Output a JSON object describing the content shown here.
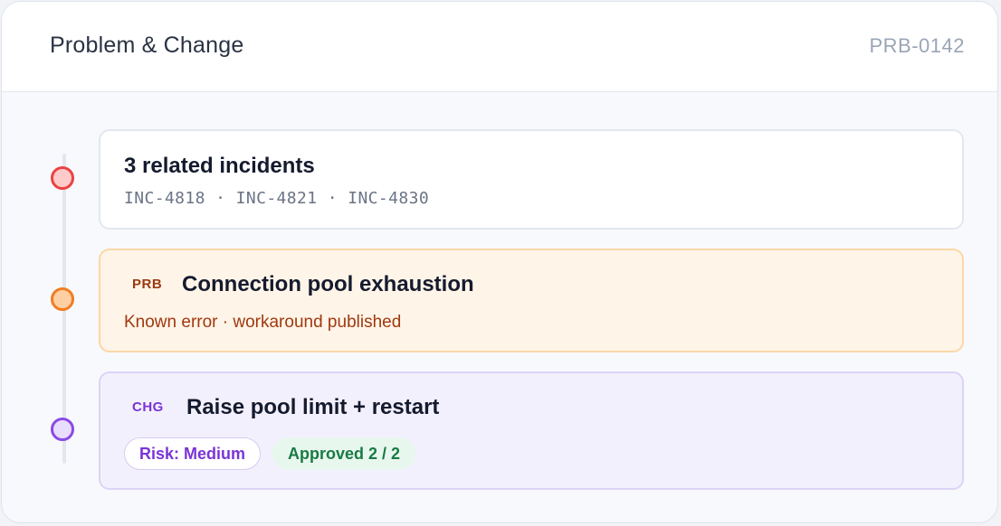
{
  "header": {
    "title": "Problem & Change",
    "reference": "PRB-0142"
  },
  "timeline": {
    "incident": {
      "title": "3 related incidents",
      "ids": "INC-4818 · INC-4821 · INC-4830",
      "dot_color": "#ea4343"
    },
    "problem": {
      "tag": "PRB",
      "title": "Connection pool exhaustion",
      "status": "Known error · workaround published",
      "dot_color": "#f07d22"
    },
    "change": {
      "tag": "CHG",
      "title": "Raise pool limit + restart",
      "risk": "Risk: Medium",
      "approval": "Approved 2 / 2",
      "dot_color": "#8a4ae6"
    }
  }
}
